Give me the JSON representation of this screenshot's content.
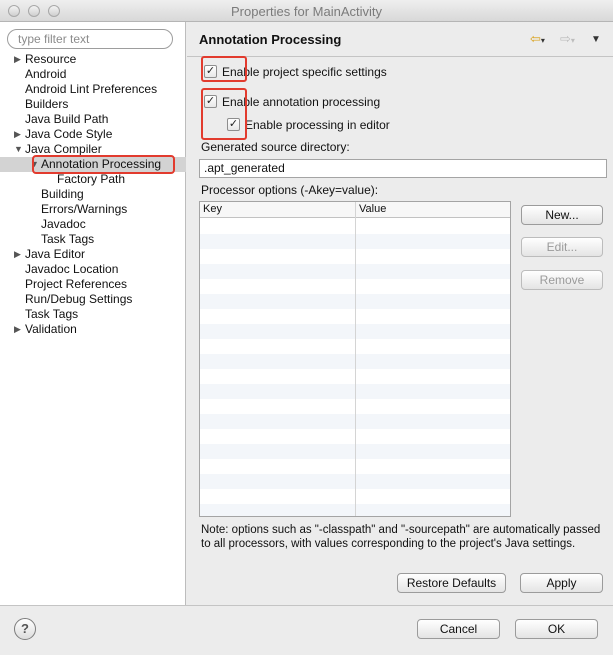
{
  "window": {
    "title": "Properties for MainActivity"
  },
  "filter": {
    "placeholder": "type filter text"
  },
  "tree": [
    {
      "label": "Resource",
      "level": 0,
      "expandable": true,
      "expanded": false
    },
    {
      "label": "Android",
      "level": 0,
      "expandable": false
    },
    {
      "label": "Android Lint Preferences",
      "level": 0,
      "expandable": false
    },
    {
      "label": "Builders",
      "level": 0,
      "expandable": false
    },
    {
      "label": "Java Build Path",
      "level": 0,
      "expandable": false
    },
    {
      "label": "Java Code Style",
      "level": 0,
      "expandable": true,
      "expanded": false
    },
    {
      "label": "Java Compiler",
      "level": 0,
      "expandable": true,
      "expanded": true
    },
    {
      "label": "Annotation Processing",
      "level": 1,
      "expandable": true,
      "expanded": true,
      "selected": true
    },
    {
      "label": "Factory Path",
      "level": 2,
      "expandable": false
    },
    {
      "label": "Building",
      "level": 1,
      "expandable": false
    },
    {
      "label": "Errors/Warnings",
      "level": 1,
      "expandable": false
    },
    {
      "label": "Javadoc",
      "level": 1,
      "expandable": false
    },
    {
      "label": "Task Tags",
      "level": 1,
      "expandable": false
    },
    {
      "label": "Java Editor",
      "level": 0,
      "expandable": true,
      "expanded": false
    },
    {
      "label": "Javadoc Location",
      "level": 0,
      "expandable": false
    },
    {
      "label": "Project References",
      "level": 0,
      "expandable": false
    },
    {
      "label": "Run/Debug Settings",
      "level": 0,
      "expandable": false
    },
    {
      "label": "Task Tags",
      "level": 0,
      "expandable": false
    },
    {
      "label": "Validation",
      "level": 0,
      "expandable": true,
      "expanded": false
    }
  ],
  "page": {
    "title": "Annotation Processing",
    "enable_project_specific": {
      "label": "Enable project specific settings",
      "checked": true
    },
    "enable_annotation_processing": {
      "label": "Enable annotation processing",
      "checked": true
    },
    "enable_in_editor": {
      "label": "Enable processing in editor",
      "checked": true
    },
    "gen_dir_label": "Generated source directory:",
    "gen_dir_value": ".apt_generated",
    "processor_options_label": "Processor options (-Akey=value):",
    "table_headers": {
      "key": "Key",
      "value": "Value"
    },
    "buttons": {
      "new": "New...",
      "edit": "Edit...",
      "remove": "Remove"
    },
    "note": "Note: options such as \"-classpath\" and \"-sourcepath\" are automatically passed to all processors, with values corresponding to the project's Java settings.",
    "restore_defaults": "Restore Defaults",
    "apply": "Apply"
  },
  "footer": {
    "cancel": "Cancel",
    "ok": "OK",
    "help": "?"
  },
  "colors": {
    "highlight_red": "#e23b2e",
    "selection_gray": "#d3d3d3"
  },
  "icons": {
    "back": "back-arrow-icon",
    "forward": "forward-arrow-icon",
    "menu": "view-menu-icon",
    "help": "help-icon"
  }
}
